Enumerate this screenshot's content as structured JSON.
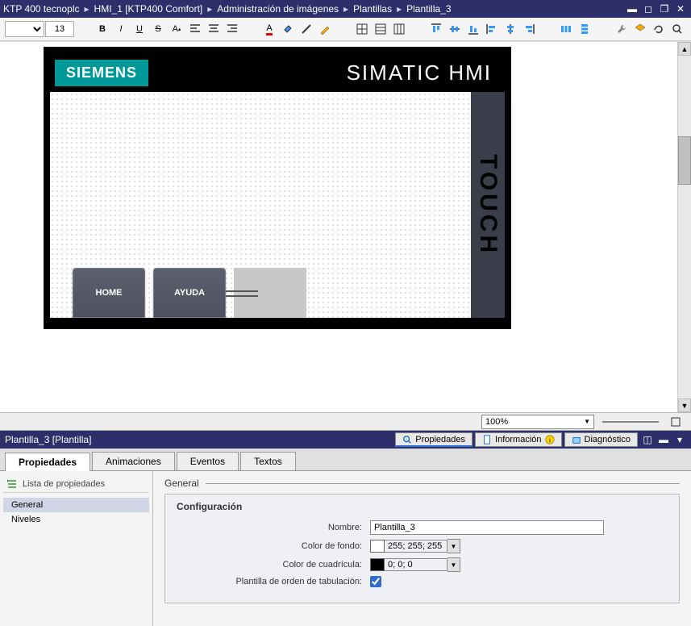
{
  "breadcrumb": [
    "KTP 400 tecnoplc",
    "HMI_1 [KTP400 Comfort]",
    "Administración de imágenes",
    "Plantillas",
    "Plantilla_3"
  ],
  "toolbar": {
    "font_size": "13"
  },
  "hmi": {
    "logo": "SIEMENS",
    "title": "SIMATIC HMI",
    "touch": "TOUCH",
    "btn_home": "HOME",
    "btn_help": "AYUDA"
  },
  "zoom": "100%",
  "props_bar": {
    "title": "Plantilla_3 [Plantilla]",
    "tab_props": "Propiedades",
    "tab_info": "Información",
    "tab_diag": "Diagnóstico"
  },
  "tabs": {
    "props": "Propiedades",
    "anim": "Animaciones",
    "events": "Eventos",
    "texts": "Textos"
  },
  "sidebar": {
    "header": "Lista de propiedades",
    "general": "General",
    "levels": "Niveles"
  },
  "config": {
    "group": "General",
    "section": "Configuración",
    "name_label": "Nombre:",
    "name_value": "Plantilla_3",
    "bg_label": "Color de fondo:",
    "bg_value": "255; 255; 255",
    "grid_label": "Color de cuadrícula:",
    "grid_value": "0; 0; 0",
    "tab_order_label": "Plantilla de orden de tabulación:"
  }
}
